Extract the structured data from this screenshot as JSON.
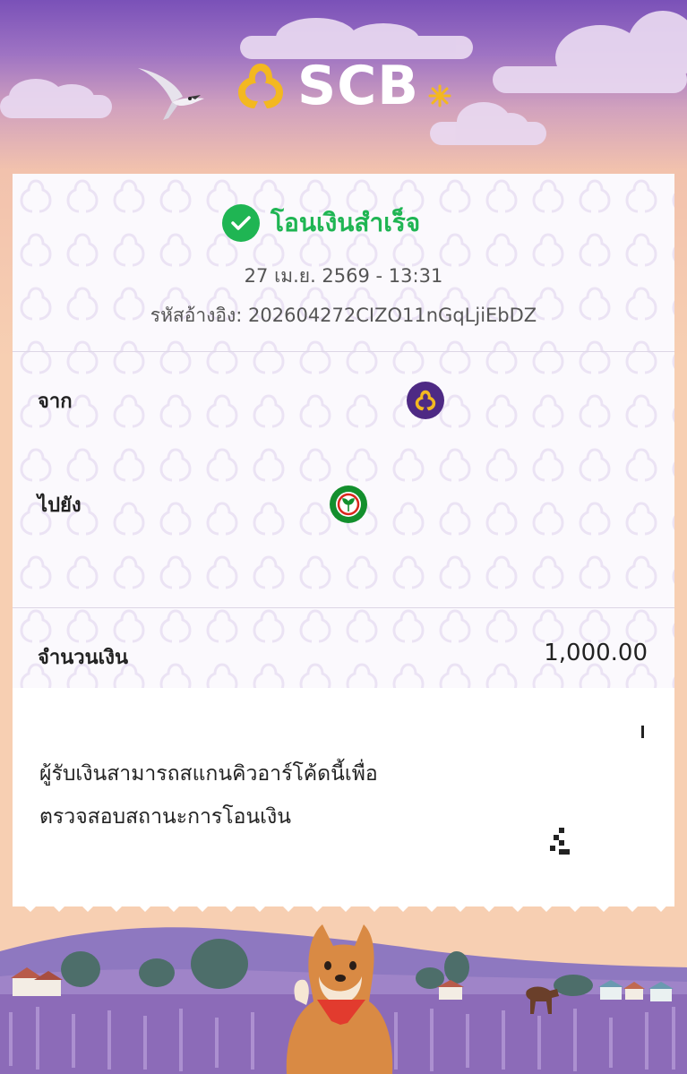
{
  "brand": {
    "name": "SCB",
    "colors": {
      "gold": "#f3b820",
      "purple": "#4e2a84",
      "success": "#1fb553"
    }
  },
  "receipt": {
    "status": "โอนเงินสำเร็จ",
    "datetime": "27 เม.ย. 2569 - 13:31",
    "reference": "รหัสอ้างอิง: 202604272CIZO11nGqLjiEbDZ",
    "from_label": "จาก",
    "to_label": "ไปยัง",
    "amount_label": "จำนวนเงิน",
    "amount_value": "1,000.00",
    "note_line1": "ผู้รับเงินสามารถสแกนคิวอาร์โค้ดนี้เพื่อ",
    "note_line2": "ตรวจสอบสถานะการโอนเงิน"
  },
  "icons": {
    "from_bank": "scb-logo-icon",
    "to_bank": "kbank-logo-icon",
    "status": "check-circle-icon"
  }
}
